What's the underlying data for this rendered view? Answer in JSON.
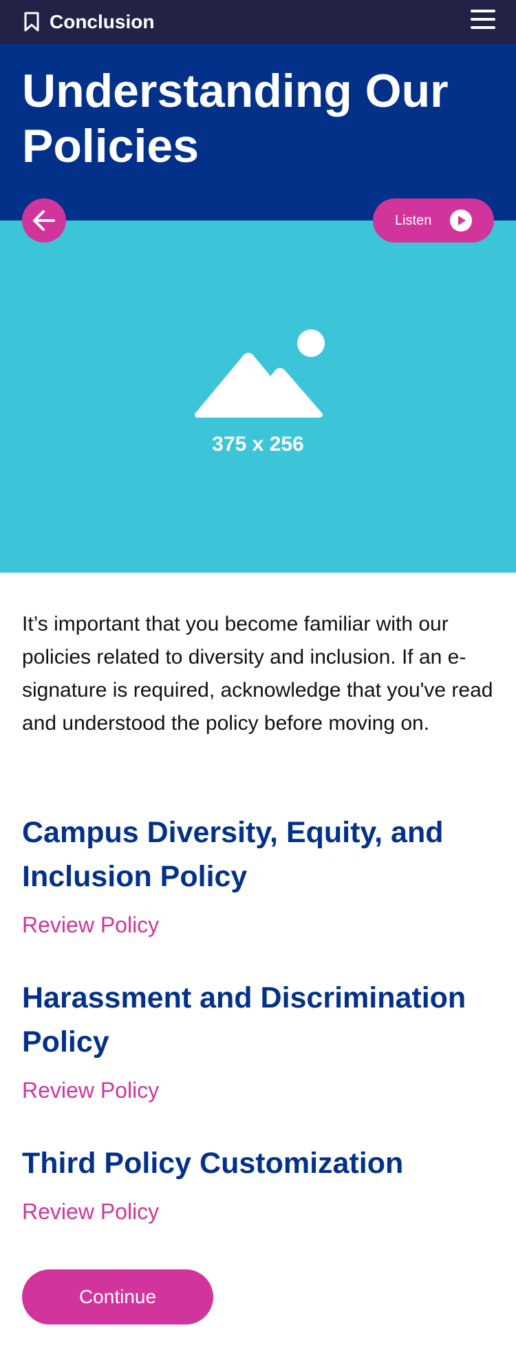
{
  "header": {
    "section_label": "Conclusion",
    "icons": {
      "bookmark": "bookmark-icon",
      "menu": "hamburger-menu-icon"
    }
  },
  "hero": {
    "title": "Understanding Our Policies"
  },
  "media": {
    "placeholder_caption": "375 x 256",
    "icon": "image-placeholder-icon",
    "background_color": "#3cc5d9"
  },
  "controls": {
    "back_icon": "arrow-left-icon",
    "listen_label": "Listen",
    "listen_icon": "play-circle-icon"
  },
  "content": {
    "intro": "It’s important that you become familiar with our policies related to diversity and inclusion. If an e-signature is required, acknowledge that you've read and understood the policy before moving on.",
    "policies": [
      {
        "title": "Campus Diversity, Equity, and Inclusion Policy",
        "link_label": "Review Policy"
      },
      {
        "title": "Harassment and Discrimination Policy",
        "link_label": "Review Policy"
      },
      {
        "title": "Third Policy Customization",
        "link_label": "Review Policy"
      }
    ],
    "continue_label": "Continue"
  },
  "colors": {
    "topbar": "#222246",
    "hero": "#03318a",
    "accent": "#d1359b",
    "heading": "#03318a"
  }
}
